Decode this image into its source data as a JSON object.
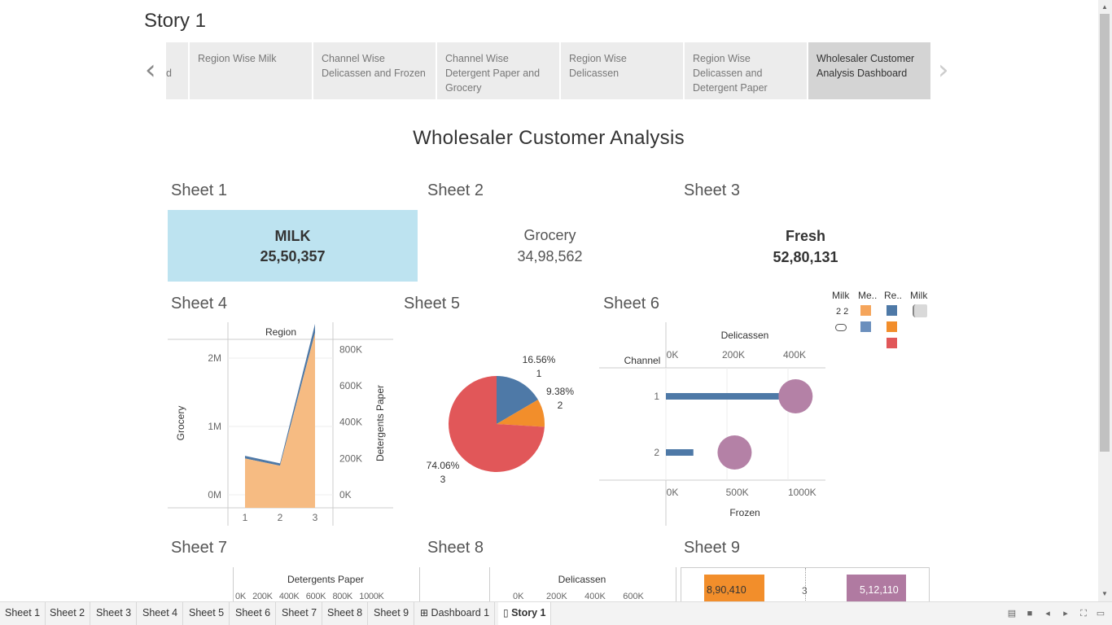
{
  "story": {
    "title": "Story 1",
    "points": [
      {
        "label": "d"
      },
      {
        "label": "Region Wise Milk"
      },
      {
        "label": "Channel Wise Delicassen and Frozen"
      },
      {
        "label": "Channel Wise Detergent Paper and Grocery"
      },
      {
        "label": "Region Wise Delicassen"
      },
      {
        "label": "Region Wise Delicassen and Detergent Paper"
      },
      {
        "label": "Wholesaler Customer Analysis Dashboard"
      }
    ]
  },
  "dashboard": {
    "title": "Wholesaler Customer Analysis",
    "sheet1": {
      "title": "Sheet 1",
      "label": "MILK",
      "value": "25,50,357"
    },
    "sheet2": {
      "title": "Sheet 2",
      "label": "Grocery",
      "value": "34,98,562"
    },
    "sheet3": {
      "title": "Sheet 3",
      "label": "Fresh",
      "value": "52,80,131"
    },
    "sheet4": {
      "title": "Sheet 4"
    },
    "sheet5": {
      "title": "Sheet 5"
    },
    "sheet6": {
      "title": "Sheet 6"
    },
    "sheet7": {
      "title": "Sheet 7",
      "axis_label": "Detergents Paper",
      "ticks": [
        "0K",
        "200K",
        "400K",
        "600K",
        "800K",
        "1000K"
      ]
    },
    "sheet8": {
      "title": "Sheet 8",
      "axis_label": "Delicassen",
      "ticks": [
        "0K",
        "200K",
        "400K",
        "600K"
      ]
    },
    "sheet9": {
      "title": "Sheet 9",
      "left_label": "8,90,410",
      "mid_label": "3",
      "right_label": "5,12,110"
    }
  },
  "legend": {
    "headers": [
      "Milk",
      "Me..",
      "Re..",
      "Milk"
    ],
    "milk_values": "2 2",
    "colors": {
      "light_orange": "#f5a55b",
      "steel_blue": "#4e79a7",
      "mid_blue": "#6b8fbd",
      "orange": "#f28e2b",
      "red": "#e15759",
      "grey": "#d9d9d9"
    }
  },
  "chart_data": [
    {
      "chart": "sheet4",
      "type": "area",
      "header": "Region",
      "categories": [
        "1",
        "2",
        "3"
      ],
      "xlabel": "",
      "ylabel": "Grocery",
      "y2label": "Detergents Paper",
      "ylim": [
        0,
        2500000
      ],
      "y2lim": [
        0,
        940000
      ],
      "yticks": [
        "0M",
        "1M",
        "2M"
      ],
      "y2ticks": [
        "0K",
        "200K",
        "400K",
        "600K",
        "800K"
      ],
      "series": [
        {
          "name": "Grocery",
          "values": [
            570000,
            460000,
            2500000
          ],
          "color": "#4e79a7"
        },
        {
          "name": "Detergents Paper",
          "values": [
            200000,
            160000,
            890000
          ],
          "color": "#f5b77b"
        }
      ]
    },
    {
      "chart": "sheet5",
      "type": "pie",
      "slices": [
        {
          "label": "1",
          "percent": 16.56,
          "pct_label": "16.56%",
          "color": "#4e79a7"
        },
        {
          "label": "2",
          "percent": 9.38,
          "pct_label": "9.38%",
          "color": "#f28e2b"
        },
        {
          "label": "3",
          "percent": 74.06,
          "pct_label": "74.06%",
          "color": "#e15759"
        }
      ]
    },
    {
      "chart": "sheet6",
      "type": "bar",
      "row_header": "Channel",
      "top_axis_label": "Delicassen",
      "bottom_axis_label": "Frozen",
      "categories": [
        "1",
        "2"
      ],
      "top_ticks": [
        "0K",
        "200K",
        "400K"
      ],
      "bottom_ticks": [
        "0K",
        "500K",
        "1000K"
      ],
      "xlim_top": [
        0,
        480000
      ],
      "xlim_bottom": [
        0,
        1130000
      ],
      "series": [
        {
          "name": "Delicassen",
          "values": [
            370000,
            90000
          ],
          "color": "#4e79a7"
        },
        {
          "name": "Frozen",
          "values": [
            1000000,
            530000
          ],
          "color": "#b07aa1"
        }
      ]
    }
  ]
}
